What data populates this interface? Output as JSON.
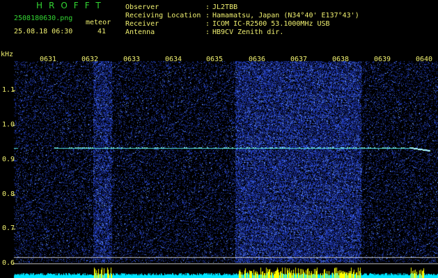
{
  "header": {
    "program": "HROFFT",
    "filename": "2508180630.png",
    "datetime": "25.08.18 06:30",
    "count_label": "meteor",
    "count_value": "41"
  },
  "station": {
    "rows": [
      {
        "label": "Observer",
        "value": "JL2TBB"
      },
      {
        "label": "Receiving Location",
        "value": "Hamamatsu, Japan (N34°40' E137°43')"
      },
      {
        "label": "Receiver",
        "value": "ICOM IC-R2500 53.1000MHz USB"
      },
      {
        "label": "Antenna",
        "value": "HB9CV Zenith dir."
      }
    ],
    "separator": ":"
  },
  "axes": {
    "y_unit": "kHz",
    "y_ticks": [
      "1.1",
      "1.0",
      "0.9",
      "0.8",
      "0.7",
      "0.6"
    ],
    "x_ticks": [
      "0631",
      "0632",
      "0633",
      "0634",
      "0635",
      "0636",
      "0637",
      "0638",
      "0639",
      "0640"
    ]
  },
  "colors": {
    "label_yellow": "#f0f070",
    "title_green": "#33d633",
    "noise_blue": "#2040c0",
    "carrier": "#60ffd0",
    "level_cyan": "#00e5ff",
    "level_yellow": "#ffff00"
  }
}
